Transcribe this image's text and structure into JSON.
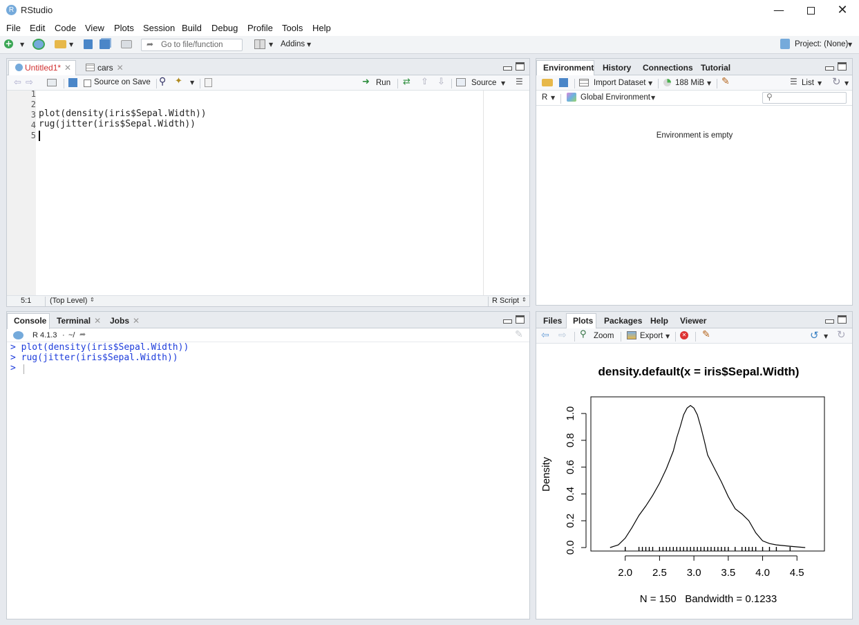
{
  "window": {
    "title": "RStudio",
    "app_icon_letter": "R"
  },
  "menu": [
    "File",
    "Edit",
    "Code",
    "View",
    "Plots",
    "Session",
    "Build",
    "Debug",
    "Profile",
    "Tools",
    "Help"
  ],
  "toolbar": {
    "goto_placeholder": "Go to file/function",
    "addins_label": "Addins",
    "project_label": "Project: (None)"
  },
  "editor": {
    "tabs": [
      {
        "label": "Untitled1*",
        "modified": true
      },
      {
        "label": "cars"
      }
    ],
    "source_on_save_label": "Source on Save",
    "run_label": "Run",
    "source_label": "Source",
    "line_numbers": [
      "1",
      "2",
      "3",
      "4",
      "5"
    ],
    "lines": [
      "",
      "",
      "plot(density(iris$Sepal.Width))",
      "rug(jitter(iris$Sepal.Width))",
      ""
    ],
    "status": {
      "position": "5:1",
      "scope": "(Top Level)",
      "filetype": "R Script"
    }
  },
  "environment": {
    "tabs": [
      "Environment",
      "History",
      "Connections",
      "Tutorial"
    ],
    "import_label": "Import Dataset",
    "memory_label": "188 MiB",
    "list_label": "List",
    "lang_label": "R",
    "scope_label": "Global Environment",
    "empty_message": "Environment is empty"
  },
  "console": {
    "tabs": [
      "Console",
      "Terminal",
      "Jobs"
    ],
    "version": "R 4.1.3",
    "path": "~/",
    "lines": [
      "> plot(density(iris$Sepal.Width))",
      "> rug(jitter(iris$Sepal.Width))",
      "> "
    ]
  },
  "files_pane": {
    "tabs": [
      "Files",
      "Plots",
      "Packages",
      "Help",
      "Viewer"
    ],
    "zoom_label": "Zoom",
    "export_label": "Export"
  },
  "chart_data": {
    "type": "line",
    "title": "density.default(x = iris$Sepal.Width)",
    "xlabel": "N = 150   Bandwidth = 0.1233",
    "ylabel": "Density",
    "xlim": [
      1.5,
      4.9
    ],
    "ylim": [
      0,
      1.15
    ],
    "x_ticks": [
      "2.0",
      "2.5",
      "3.0",
      "3.5",
      "4.0",
      "4.5"
    ],
    "x_tick_values": [
      2.0,
      2.5,
      3.0,
      3.5,
      4.0,
      4.5
    ],
    "y_ticks": [
      "0.0",
      "0.2",
      "0.4",
      "0.6",
      "0.8",
      "1.0"
    ],
    "y_tick_values": [
      0,
      0.2,
      0.4,
      0.6,
      0.8,
      1.0
    ],
    "series": [
      {
        "x": [
          1.78,
          1.9,
          2.0,
          2.1,
          2.2,
          2.3,
          2.4,
          2.5,
          2.6,
          2.7,
          2.75,
          2.8,
          2.85,
          2.9,
          2.95,
          3.0,
          3.05,
          3.1,
          3.15,
          3.2,
          3.3,
          3.4,
          3.5,
          3.6,
          3.7,
          3.8,
          3.9,
          4.0,
          4.1,
          4.2,
          4.3,
          4.4,
          4.5,
          4.62
        ],
        "y": [
          0.0,
          0.02,
          0.07,
          0.15,
          0.24,
          0.31,
          0.39,
          0.48,
          0.59,
          0.72,
          0.82,
          0.9,
          0.99,
          1.04,
          1.06,
          1.04,
          0.99,
          0.9,
          0.8,
          0.69,
          0.59,
          0.49,
          0.38,
          0.29,
          0.25,
          0.2,
          0.11,
          0.05,
          0.03,
          0.02,
          0.015,
          0.01,
          0.005,
          0.0
        ]
      }
    ],
    "rug": [
      2.0,
      2.2,
      2.25,
      2.3,
      2.35,
      2.4,
      2.5,
      2.55,
      2.6,
      2.65,
      2.7,
      2.75,
      2.8,
      2.85,
      2.9,
      2.95,
      3.0,
      3.05,
      3.1,
      3.15,
      3.2,
      3.25,
      3.3,
      3.35,
      3.4,
      3.45,
      3.5,
      3.6,
      3.7,
      3.75,
      3.8,
      3.85,
      3.9,
      4.0,
      4.1,
      4.2,
      4.4
    ],
    "grid": false
  }
}
